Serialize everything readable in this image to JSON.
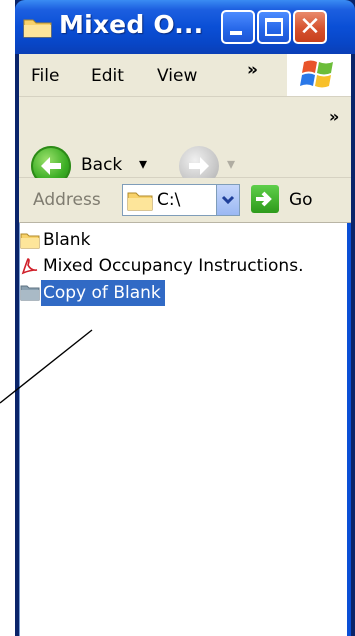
{
  "window": {
    "title": "Mixed O..."
  },
  "menubar": {
    "items": [
      "File",
      "Edit",
      "View"
    ],
    "overflow": "»"
  },
  "toolbar": {
    "back_label": "Back",
    "dropdown_glyph": "▾",
    "overflow": "»"
  },
  "addressbar": {
    "label": "Address",
    "value": "C:\\",
    "go_label": "Go"
  },
  "files": [
    {
      "name": "Blank",
      "type": "folder",
      "selected": false
    },
    {
      "name": "Mixed Occupancy Instructions.",
      "type": "pdf",
      "selected": false
    },
    {
      "name": "Copy of Blank",
      "type": "folder",
      "selected": true
    }
  ],
  "colors": {
    "titlebar": "#0a4fd6",
    "selection": "#316ac5",
    "chrome": "#ece9d8"
  },
  "icons": [
    "folder-icon",
    "minimize-icon",
    "maximize-icon",
    "close-icon",
    "back-arrow-icon",
    "forward-arrow-icon",
    "windows-logo-icon",
    "go-arrow-icon",
    "pdf-icon",
    "dropdown-icon"
  ]
}
